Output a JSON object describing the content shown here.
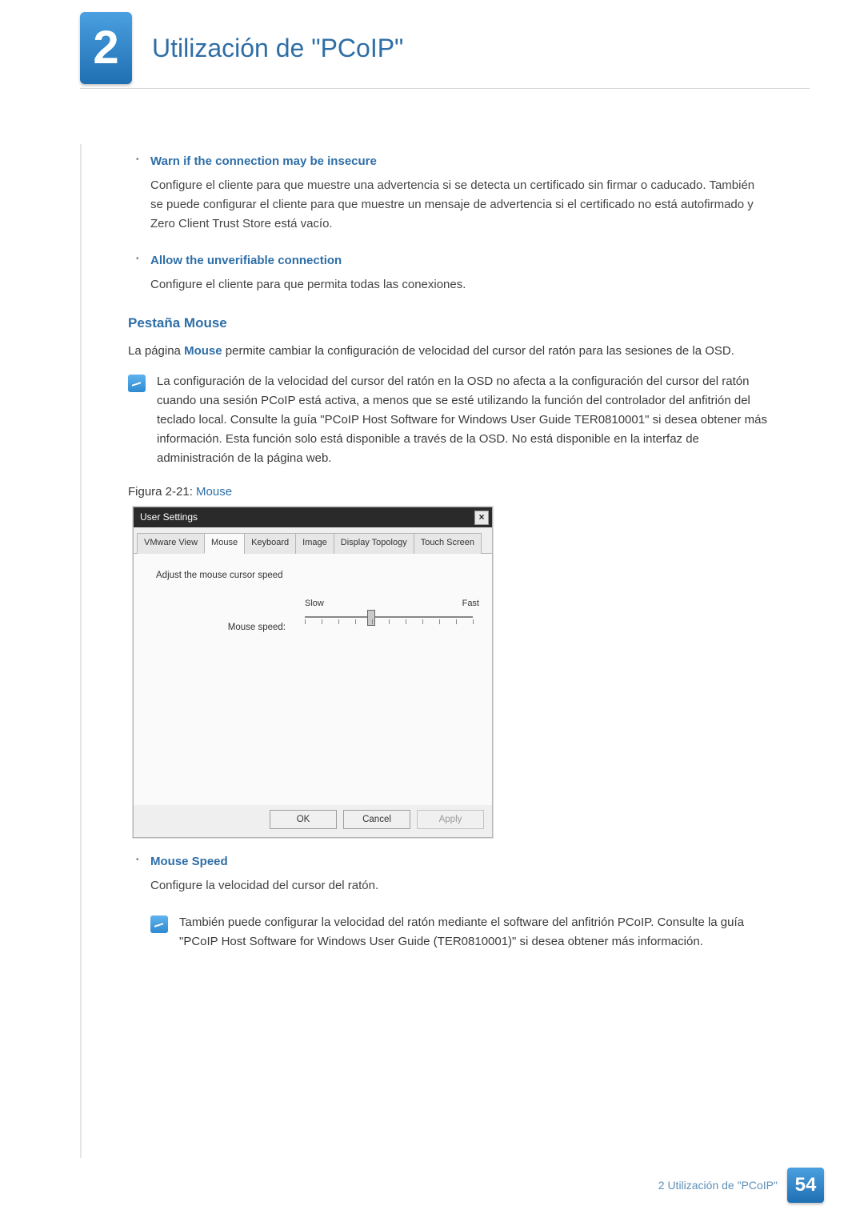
{
  "chapter": {
    "number": "2",
    "title": "Utilización de \"PCoIP\""
  },
  "items": {
    "warn": {
      "head": "Warn if the connection may be insecure",
      "body": "Configure el cliente para que muestre una advertencia si se detecta un certificado sin firmar o caducado. También se puede configurar el cliente para que muestre un mensaje de advertencia si el certificado no está autofirmado y Zero Client Trust Store está vacío."
    },
    "allow": {
      "head": "Allow the unverifiable connection",
      "body": "Configure el cliente para que permita todas las conexiones."
    },
    "mspeed": {
      "head": "Mouse Speed",
      "body": "Configure la velocidad del cursor del ratón."
    }
  },
  "section": {
    "mouse_head": "Pestaña Mouse"
  },
  "para": {
    "pre": "La página ",
    "hl": "Mouse",
    "post": " permite cambiar la configuración de velocidad del cursor del ratón para las sesiones de la OSD."
  },
  "note1": "La configuración de la velocidad del cursor del ratón en la OSD no afecta a la configuración del cursor del ratón cuando una sesión PCoIP está activa, a menos que se esté utilizando la función del controlador del anfitrión del teclado local. Consulte la guía \"PCoIP Host Software for Windows User Guide TER0810001\" si desea obtener más información. Esta función solo está disponible a través de la OSD. No está disponible en la interfaz de administración de la página web.",
  "figcap": {
    "pre": "Figura 2-21: ",
    "hl": "Mouse"
  },
  "dialog": {
    "title": "User Settings",
    "tabs": [
      "VMware View",
      "Mouse",
      "Keyboard",
      "Image",
      "Display Topology",
      "Touch Screen"
    ],
    "active_tab": 1,
    "adjust_label": "Adjust the mouse cursor speed",
    "speed_label": "Mouse speed:",
    "slow": "Slow",
    "fast": "Fast",
    "buttons": {
      "ok": "OK",
      "cancel": "Cancel",
      "apply": "Apply"
    }
  },
  "note2": "También puede configurar la velocidad del ratón mediante el software del anfitrión PCoIP. Consulte la guía \"PCoIP Host Software for Windows User Guide (TER0810001)\" si desea obtener más información.",
  "footer": {
    "label": "2 Utilización de \"PCoIP\"",
    "page": "54"
  }
}
